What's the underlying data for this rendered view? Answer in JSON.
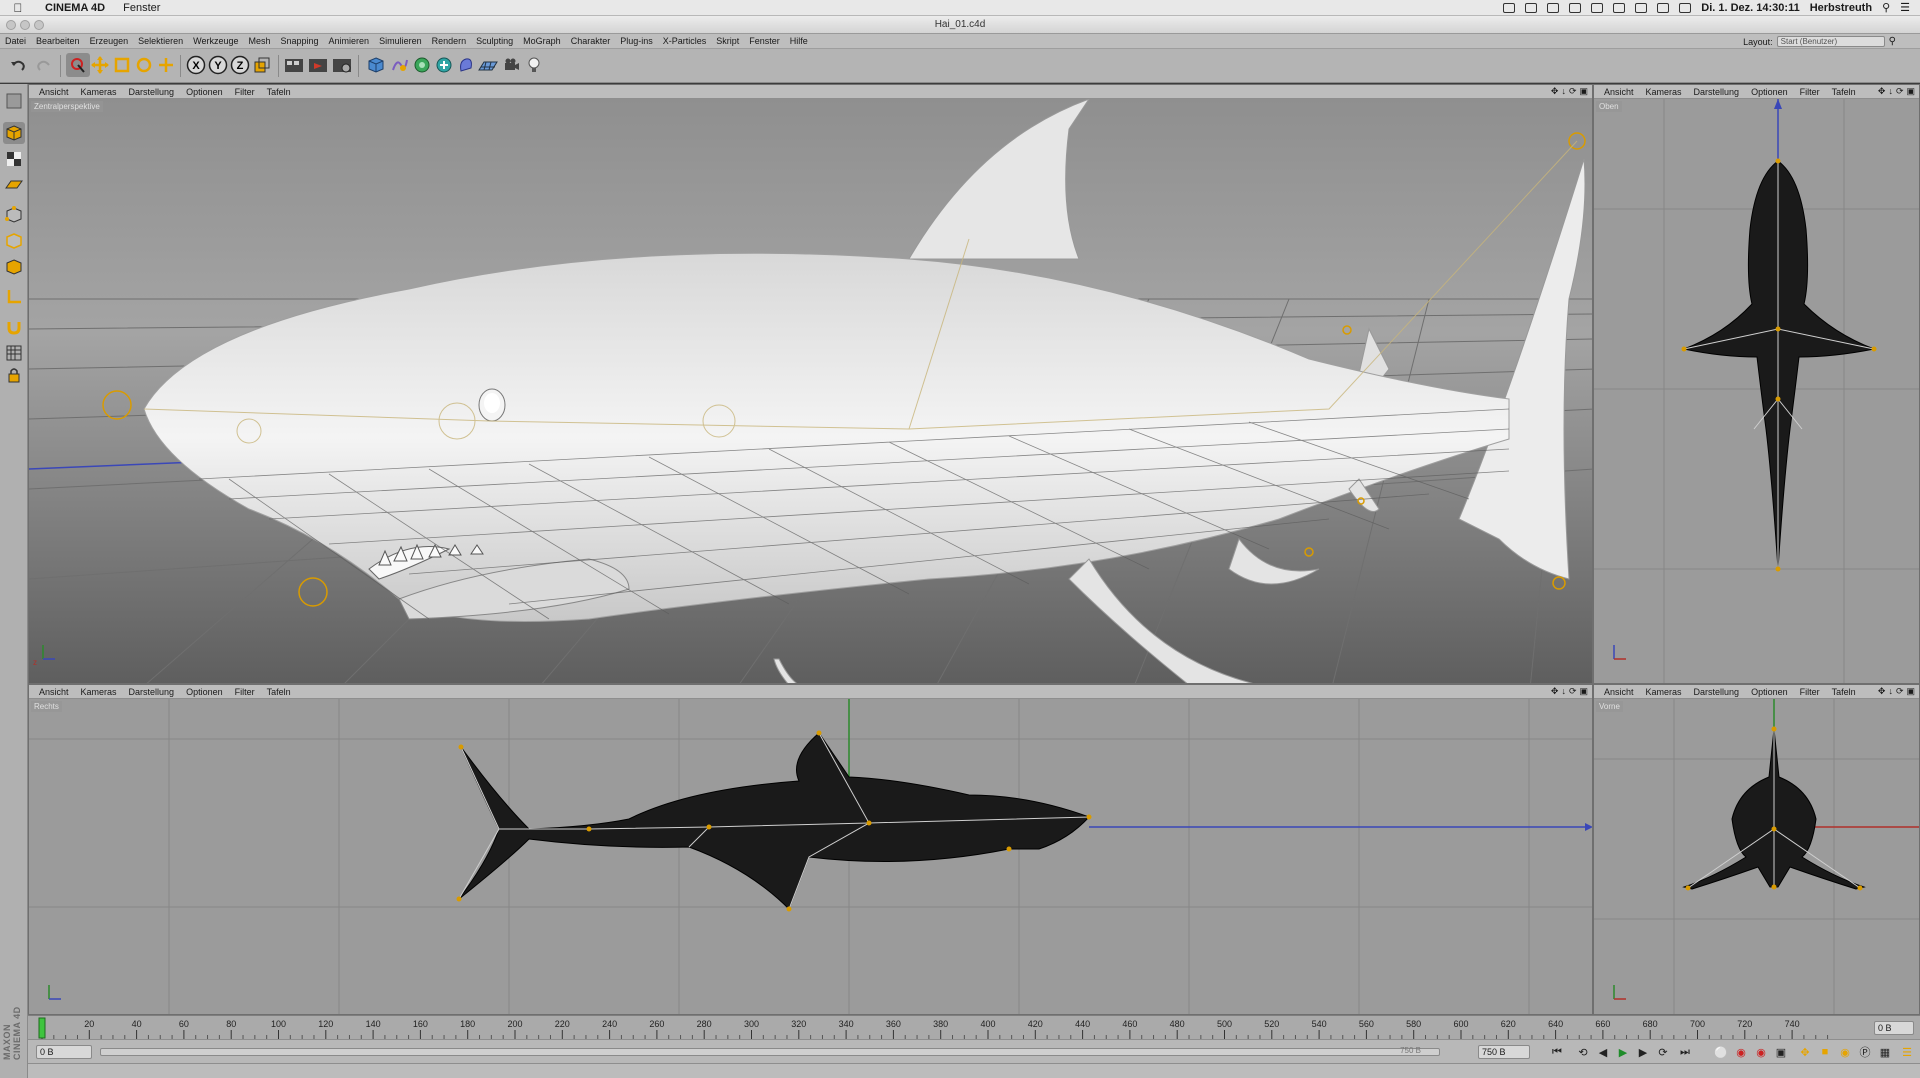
{
  "macos": {
    "app_name": "CINEMA 4D",
    "menu": [
      "Fenster"
    ],
    "clock": "Di. 1. Dez.  14:30:11",
    "user": "Herbstreuth"
  },
  "window": {
    "title": "Hai_01.c4d"
  },
  "menubar": {
    "items": [
      "Datei",
      "Bearbeiten",
      "Erzeugen",
      "Selektieren",
      "Werkzeuge",
      "Mesh",
      "Snapping",
      "Animieren",
      "Simulieren",
      "Rendern",
      "Sculpting",
      "MoGraph",
      "Charakter",
      "Plug-ins",
      "X-Particles",
      "Skript",
      "Fenster",
      "Hilfe"
    ],
    "layout_label": "Layout:",
    "layout_value": "Start (Benutzer)"
  },
  "viewport_menu": [
    "Ansicht",
    "Kameras",
    "Darstellung",
    "Optionen",
    "Filter",
    "Tafeln"
  ],
  "viewports": {
    "perspective": "Zentralperspektive",
    "top": "Oben",
    "right": "Rechts",
    "front": "Vorne"
  },
  "toolbar": {
    "axis_x": "X",
    "axis_y": "Y",
    "axis_z": "Z"
  },
  "timeline": {
    "ticks": [
      "0",
      "20",
      "40",
      "60",
      "80",
      "100",
      "120",
      "140",
      "160",
      "180",
      "200",
      "220",
      "240",
      "260",
      "280",
      "300",
      "320",
      "340",
      "360",
      "380",
      "400",
      "420",
      "440",
      "460",
      "480",
      "500",
      "520",
      "540",
      "560",
      "580",
      "600",
      "620",
      "640",
      "660",
      "680",
      "700",
      "720",
      "740"
    ],
    "current_frame": "0 B",
    "start_field": "0 B",
    "end_field_a": "750 B",
    "end_field_b": "750 B"
  },
  "branding": "MAXON CINEMA 4D",
  "colors": {
    "viewport_bg": "#9b9b9b",
    "grid": "#7d7d7d",
    "shark": "#efefef",
    "wire": "#111111",
    "bone": "#d6c28c",
    "x_axis": "#b0302a",
    "y_axis": "#2d8a2d",
    "z_axis": "#2f3fb0"
  }
}
